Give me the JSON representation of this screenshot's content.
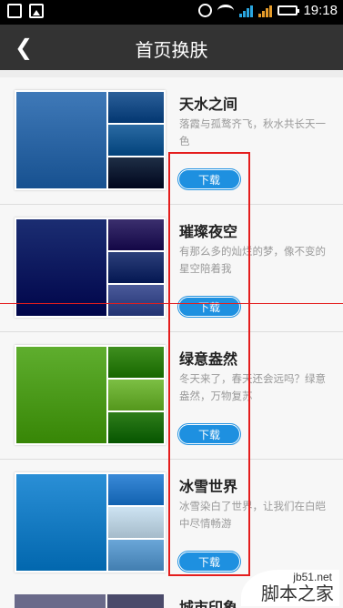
{
  "status_bar": {
    "time": "19:18",
    "icons": [
      "notification-icon",
      "image-icon",
      "alarm-icon",
      "wifi-icon",
      "signal-icon",
      "signal-3g-icon",
      "battery-icon"
    ]
  },
  "header": {
    "title": "首页换肤",
    "back_icon": "back-arrow-icon"
  },
  "themes": [
    {
      "name": "天水之间",
      "desc": "落霞与孤鹜齐飞，秋水共长天一色",
      "download_label": "下载",
      "colors": [
        "#3f79b8",
        "#2b5f99",
        "#2a6aa3",
        "#1e2e45"
      ]
    },
    {
      "name": "璀璨夜空",
      "desc": "有那么多的灿烂的梦，像不变的星空陪着我",
      "download_label": "下载",
      "colors": [
        "#1b2d72",
        "#3b2f6e",
        "#2c3f7a",
        "#4a5a9a"
      ]
    },
    {
      "name": "绿意盎然",
      "desc": "冬天来了，春天还会远吗？绿意盎然，万物复苏",
      "download_label": "下载",
      "colors": [
        "#5fae2e",
        "#3f8f1f",
        "#7cbf44",
        "#2e7d1a"
      ]
    },
    {
      "name": "冰雪世界",
      "desc": "冰雪染白了世界，让我们在白皑中尽情畅游",
      "download_label": "下载",
      "colors": [
        "#2a8fd6",
        "#3a8ad8",
        "#cde3f2",
        "#6aa6d8"
      ]
    }
  ],
  "partial_item": {
    "name": "城市印象",
    "colors": [
      "#6a6a8a",
      "#4a4a6a"
    ]
  },
  "watermark": {
    "site": "jb51.net",
    "name": "脚本之家"
  },
  "accent_colors": {
    "title_bar": "#333333",
    "download_button": "#1e90e0",
    "annotation": "#e41d1d"
  }
}
